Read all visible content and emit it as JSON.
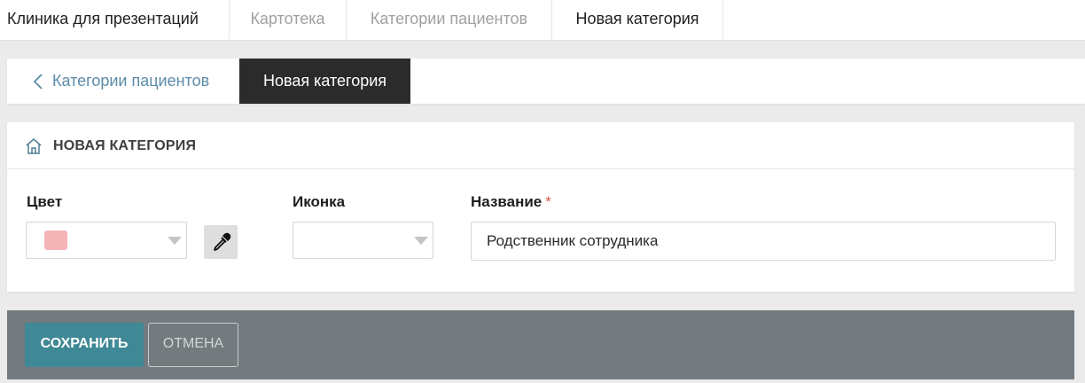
{
  "breadcrumb": {
    "items": [
      {
        "label": "Клиника для презентаций"
      },
      {
        "label": "Картотека"
      },
      {
        "label": "Категории пациентов"
      },
      {
        "label": "Новая категория"
      }
    ]
  },
  "tabs": {
    "back_label": "Категории пациентов",
    "active_label": "Новая категория"
  },
  "form": {
    "header_title": "НОВАЯ КАТЕГОРИЯ",
    "color_label": "Цвет",
    "color_value": "#f5b5b8",
    "icon_label": "Иконка",
    "name_label": "Название",
    "required_mark": "*",
    "name_value": "Родственник сотрудника"
  },
  "actions": {
    "save_label": "СОХРАНИТЬ",
    "cancel_label": "ОТМЕНА"
  },
  "colors": {
    "accent": "#3f8895",
    "link": "#5b8ca8",
    "active_tab_bg": "#2b2b2b",
    "action_bar_bg": "#737b7f"
  }
}
